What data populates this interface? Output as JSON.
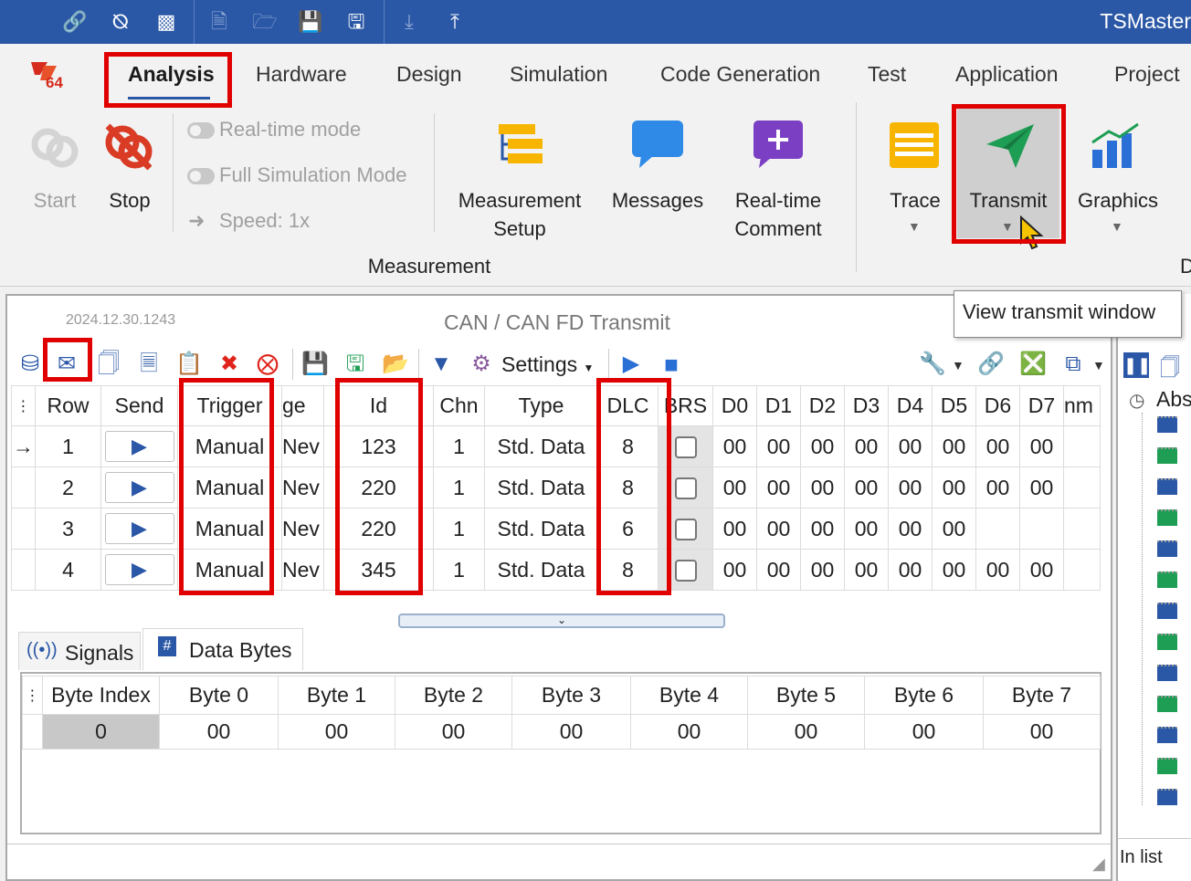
{
  "app_title": "TSMaster",
  "menu": {
    "logo": "64",
    "tabs": [
      "Analysis",
      "Hardware",
      "Design",
      "Simulation",
      "Code Generation",
      "Test",
      "Application",
      "Project"
    ]
  },
  "ribbon": {
    "start": "Start",
    "stop": "Stop",
    "realtime_mode": "Real-time mode",
    "full_sim_mode": "Full Simulation Mode",
    "speed": "Speed: 1x",
    "meas_setup_l1": "Measurement",
    "meas_setup_l2": "Setup",
    "messages": "Messages",
    "rt_comment_l1": "Real-time",
    "rt_comment_l2": "Comment",
    "group_measurement": "Measurement",
    "trace": "Trace",
    "transmit": "Transmit",
    "graphics": "Graphics",
    "edge_letter": "D"
  },
  "tooltip": "View transmit window",
  "window": {
    "version": "2024.12.30.1243",
    "title": "CAN / CAN FD Transmit",
    "settings": "Settings"
  },
  "grid": {
    "headers": [
      "Row",
      "Send",
      "Trigger",
      "ge",
      "Id",
      "Chn",
      "Type",
      "DLC",
      "BRS",
      "D0",
      "D1",
      "D2",
      "D3",
      "D4",
      "D5",
      "D6",
      "D7",
      "nm"
    ],
    "rows": [
      {
        "row": "1",
        "trigger": "Manual",
        "name": "Nev",
        "id": "123",
        "chn": "1",
        "type": "Std. Data",
        "dlc": "8",
        "d": [
          "00",
          "00",
          "00",
          "00",
          "00",
          "00",
          "00",
          "00"
        ]
      },
      {
        "row": "2",
        "trigger": "Manual",
        "name": "Nev",
        "id": "220",
        "chn": "1",
        "type": "Std. Data",
        "dlc": "8",
        "d": [
          "00",
          "00",
          "00",
          "00",
          "00",
          "00",
          "00",
          "00"
        ]
      },
      {
        "row": "3",
        "trigger": "Manual",
        "name": "Nev",
        "id": "220",
        "chn": "1",
        "type": "Std. Data",
        "dlc": "6",
        "d": [
          "00",
          "00",
          "00",
          "00",
          "00",
          "00",
          "",
          ""
        ]
      },
      {
        "row": "4",
        "trigger": "Manual",
        "name": "Nev",
        "id": "345",
        "chn": "1",
        "type": "Std. Data",
        "dlc": "8",
        "d": [
          "00",
          "00",
          "00",
          "00",
          "00",
          "00",
          "00",
          "00"
        ]
      }
    ]
  },
  "subtabs": [
    "Signals",
    "Data Bytes"
  ],
  "bytes_table": {
    "headers": [
      "Byte Index",
      "Byte 0",
      "Byte 1",
      "Byte 2",
      "Byte 3",
      "Byte 4",
      "Byte 5",
      "Byte 6",
      "Byte 7"
    ],
    "row": [
      "0",
      "00",
      "00",
      "00",
      "00",
      "00",
      "00",
      "00",
      "00"
    ]
  },
  "right_pane": {
    "header": "Abs",
    "footer": "In list"
  },
  "colors": {
    "titlebar": "#2a57a6",
    "highlight": "#e00000",
    "accent": "#2a57a6"
  }
}
